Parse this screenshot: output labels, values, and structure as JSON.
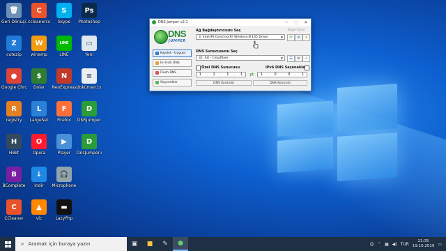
{
  "desktop": {
    "icons": [
      {
        "label": "Geri Dönüşüm...",
        "glyph": "🗑",
        "color": "#6b8fb5",
        "col": 0,
        "row": 0
      },
      {
        "label": "ccleanercs",
        "glyph": "C",
        "color": "#e8532b",
        "col": 1,
        "row": 0
      },
      {
        "label": "Skype",
        "glyph": "S",
        "color": "#00aff0",
        "col": 2,
        "row": 0
      },
      {
        "label": "Photoshop",
        "glyph": "Ps",
        "color": "#0b2a4a",
        "col": 3,
        "row": 0
      },
      {
        "label": "cutezip",
        "glyph": "Z",
        "color": "#1f7ad8",
        "col": 0,
        "row": 1
      },
      {
        "label": "winamp",
        "glyph": "W",
        "color": "#f39c12",
        "col": 1,
        "row": 1
      },
      {
        "label": "LINE",
        "glyph": "LINE",
        "color": "#00b900",
        "col": 2,
        "row": 1
      },
      {
        "label": "Yeni",
        "glyph": "▭",
        "color": "#dfe7ef",
        "col": 3,
        "row": 1
      },
      {
        "label": "Google Chrome",
        "glyph": "●",
        "color": "#db4437",
        "col": 0,
        "row": 2
      },
      {
        "label": "Dolar",
        "glyph": "$",
        "color": "#2e7d32",
        "col": 1,
        "row": 2
      },
      {
        "label": "NeoExpress",
        "glyph": "N",
        "color": "#c0392b",
        "col": 2,
        "row": 2
      },
      {
        "label": "doküman.txt",
        "glyph": "≡",
        "color": "#eceff1",
        "col": 3,
        "row": 2
      },
      {
        "label": "registry",
        "glyph": "R",
        "color": "#e67e22",
        "col": 0,
        "row": 3
      },
      {
        "label": "LargeSet",
        "glyph": "L",
        "color": "#2c81d6",
        "col": 1,
        "row": 3
      },
      {
        "label": "Firefox",
        "glyph": "F",
        "color": "#ff7139",
        "col": 2,
        "row": 3
      },
      {
        "label": "DNSJumper",
        "glyph": "D",
        "color": "#2a9d3a",
        "col": 3,
        "row": 3
      },
      {
        "label": "HiBit",
        "glyph": "H",
        "color": "#34495e",
        "col": 0,
        "row": 4
      },
      {
        "label": "Opera",
        "glyph": "O",
        "color": "#ff1b2d",
        "col": 1,
        "row": 4
      },
      {
        "label": "Player",
        "glyph": "▶",
        "color": "#4a90d9",
        "col": 2,
        "row": 4
      },
      {
        "label": "DnsJumper.exe",
        "glyph": "D",
        "color": "#2a9d3a",
        "col": 3,
        "row": 4
      },
      {
        "label": "BComplete",
        "glyph": "B",
        "color": "#7b1fa2",
        "col": 0,
        "row": 5
      },
      {
        "label": "Indir",
        "glyph": "↓",
        "color": "#1e88e5",
        "col": 1,
        "row": 5
      },
      {
        "label": "Microphone",
        "glyph": "🎧",
        "color": "#90a4ae",
        "col": 2,
        "row": 5
      },
      {
        "label": "CCleaner",
        "glyph": "C",
        "color": "#e8532b",
        "col": 0,
        "row": 6
      },
      {
        "label": "vlc",
        "glyph": "▲",
        "color": "#ff8800",
        "col": 1,
        "row": 6
      },
      {
        "label": "LazyPhp",
        "glyph": "▬",
        "color": "#111111",
        "col": 2,
        "row": 6
      }
    ]
  },
  "dns_window": {
    "title": "DNS Jumper v2.1",
    "logo_text": "DNS",
    "logo_sub": "JUMPER",
    "sidebar": [
      {
        "label": "Kaydet - Uygula",
        "color": "#3a78c8",
        "active": true
      },
      {
        "label": "En Hızlı DNS",
        "color": "#e6a23c",
        "active": false
      },
      {
        "label": "Flush DNS",
        "color": "#d9534f",
        "active": false
      },
      {
        "label": "Seçenekler",
        "color": "#5cb85c",
        "active": false
      }
    ],
    "adapter_label": "Ağ Bağdaştırıcısını Seç",
    "adapter_value": "3. Intel(R) Centrino(R) Wireless-N 135 Driver",
    "bagli_label": "Bağlı Tipini",
    "dns_server_label": "DNS Sunucusunu Seç",
    "dns_server_value": "32. AU - Cloudflare",
    "custom_dns_label": "Özel DNS Sunucusu",
    "ipv6_label": "IPv6 DNS Seçenekleri",
    "ip1": [
      "1",
      "1",
      "1",
      "1"
    ],
    "ip2": [
      "1",
      "0",
      "0",
      "1"
    ],
    "control1": "DNS Kontrolü",
    "control2": "DNS Kontrolü"
  },
  "taskbar": {
    "search_placeholder": "Aramak için buraya yazın",
    "time": "21:35",
    "date": "19.10.2019",
    "lang": "TUR"
  }
}
